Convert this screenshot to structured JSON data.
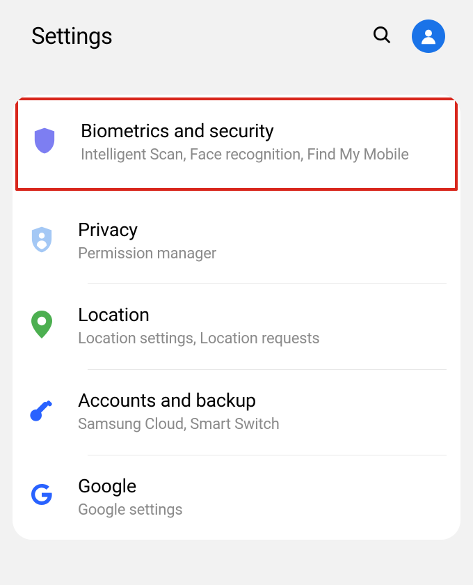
{
  "header": {
    "title": "Settings"
  },
  "items": [
    {
      "title": "Biometrics and security",
      "sub": "Intelligent Scan, Face recognition, Find My Mobile"
    },
    {
      "title": "Privacy",
      "sub": "Permission manager"
    },
    {
      "title": "Location",
      "sub": "Location settings, Location requests"
    },
    {
      "title": "Accounts and backup",
      "sub": "Samsung Cloud, Smart Switch"
    },
    {
      "title": "Google",
      "sub": "Google settings"
    }
  ]
}
